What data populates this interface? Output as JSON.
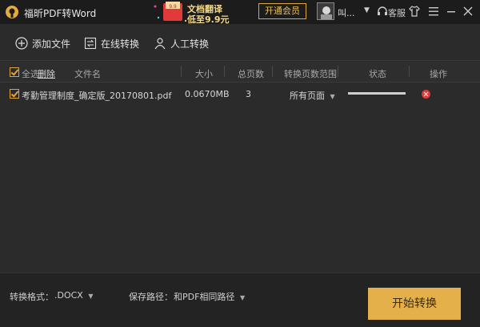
{
  "app": {
    "title": "福昕PDF转Word"
  },
  "promo": {
    "badge": "9.9",
    "line1": "文档翻译",
    "line2": "低至9.9元"
  },
  "titlebar": {
    "vip_label": "开通会员",
    "username": "叫...",
    "service_label": "客服"
  },
  "toolbar": {
    "add_file": "添加文件",
    "online_convert": "在线转换",
    "manual_convert": "人工转换"
  },
  "table": {
    "select_all": "全选",
    "delete": "删除",
    "columns": {
      "filename": "文件名",
      "size": "大小",
      "pages": "总页数",
      "range": "转换页数范围",
      "status": "状态",
      "action": "操作"
    },
    "rows": [
      {
        "checked": true,
        "filename": "考勤管理制度_确定版_20170801.pdf",
        "size": "0.0670MB",
        "pages": "3",
        "range": "所有页面",
        "progress": 1.0
      }
    ]
  },
  "footer": {
    "format_label": "转换格式：",
    "format_value": ".DOCX",
    "path_label": "保存路径：",
    "path_value": "和PDF相同路径",
    "start_button": "开始转换"
  },
  "colors": {
    "accent": "#e4b04a",
    "vip_border": "#d8a83a",
    "delete": "#d93a3a"
  }
}
